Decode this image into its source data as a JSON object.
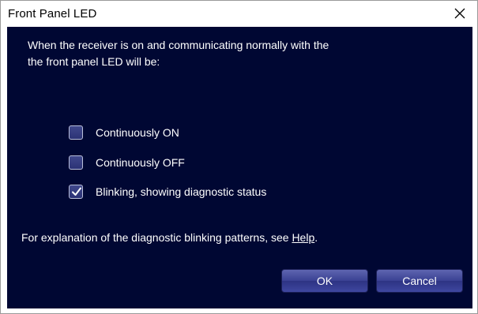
{
  "window": {
    "title": "Front Panel LED"
  },
  "icons": {
    "close": "close-icon",
    "check": "checkmark-icon"
  },
  "dialog": {
    "intro_line1": "When the receiver is on and communicating normally with the",
    "intro_line2": "the front panel LED will be:",
    "options": [
      {
        "label": "Continuously ON",
        "checked": false
      },
      {
        "label": "Continuously OFF",
        "checked": false
      },
      {
        "label": "Blinking, showing diagnostic status",
        "checked": true
      }
    ],
    "footer_prefix": "For explanation of the diagnostic blinking patterns, see ",
    "help_link": "Help",
    "footer_suffix": "."
  },
  "buttons": {
    "ok": "OK",
    "cancel": "Cancel"
  },
  "colors": {
    "panel_background": "#000733",
    "button_face": "#3a4193",
    "text": "#ffffff"
  }
}
